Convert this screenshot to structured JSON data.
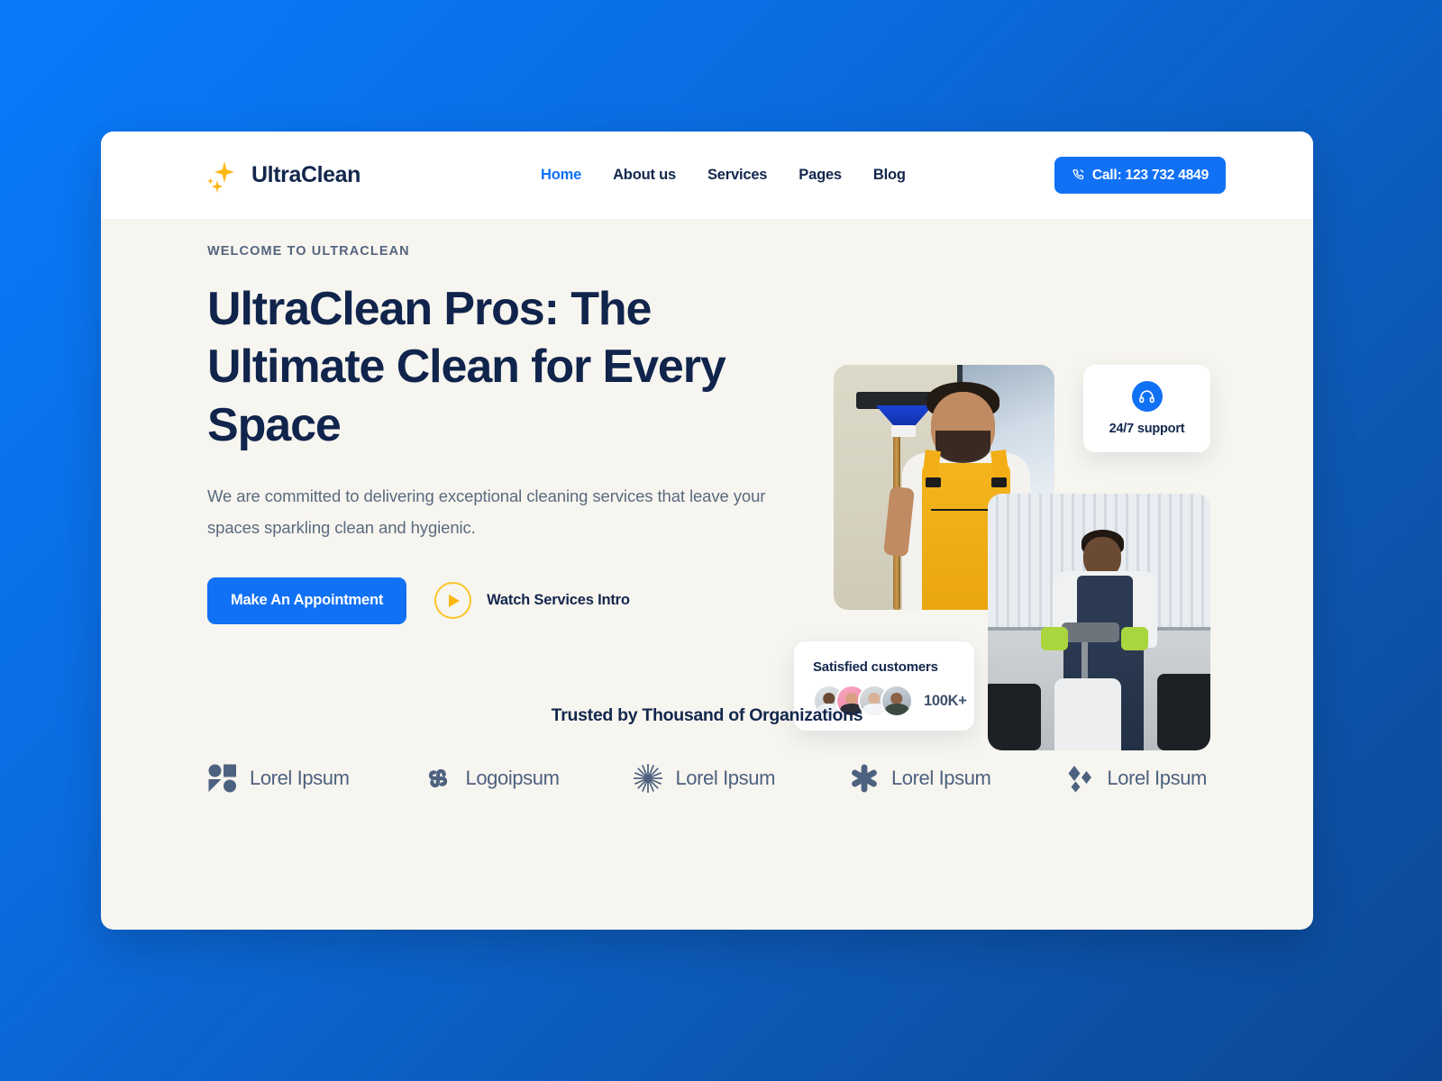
{
  "theme": {
    "page_gradient_from": "#0a7afa",
    "page_gradient_to": "#0b4896",
    "card_bg": "#f7f5ef",
    "accent_blue": "#1171f5",
    "accent_yellow": "#fcb712",
    "navy": "#13274d",
    "muted": "#5a6a80"
  },
  "nav": {
    "brand": "UltraClean",
    "brand_icon": "sparkle-icon",
    "links": [
      {
        "label": "Home",
        "active": true
      },
      {
        "label": "About us",
        "active": false
      },
      {
        "label": "Services",
        "active": false
      },
      {
        "label": "Pages",
        "active": false
      },
      {
        "label": "Blog",
        "active": false
      }
    ],
    "call_button": {
      "label": "Call: 123 732 4849",
      "icon": "phone-icon"
    }
  },
  "hero": {
    "eyebrow": "WELCOME TO ULTRACLEAN",
    "title": "UltraClean Pros: The Ultimate Clean for Every Space",
    "subtitle": "We are committed to delivering exceptional cleaning services that leave your spaces sparkling clean and hygienic.",
    "primary_cta": "Make An Appointment",
    "secondary_cta": "Watch Services Intro",
    "secondary_icon": "play-icon"
  },
  "cards": {
    "support": {
      "label": "24/7 support",
      "icon": "headset-icon"
    },
    "customers": {
      "title": "Satisfied customers",
      "count": "100K+",
      "avatar_count": 4
    }
  },
  "trusted": {
    "title": "Trusted by Thousand of Organizations",
    "logos": [
      {
        "name": "Lorel Ipsum",
        "icon": "clover-blocks-icon"
      },
      {
        "name": "Logoipsum",
        "icon": "pinwheel-icon"
      },
      {
        "name": "Lorel Ipsum",
        "icon": "sunburst-icon"
      },
      {
        "name": "Lorel Ipsum",
        "icon": "six-point-star-icon"
      },
      {
        "name": "Lorel Ipsum",
        "icon": "diamond-cluster-icon"
      }
    ]
  }
}
